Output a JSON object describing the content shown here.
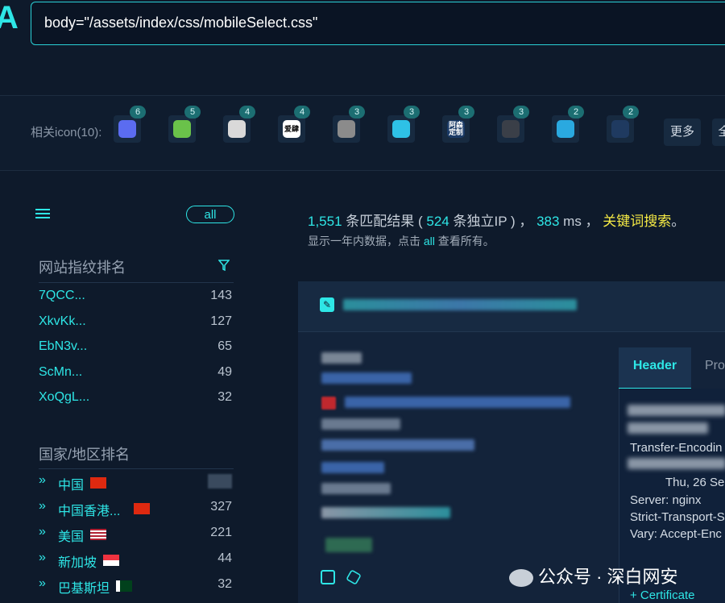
{
  "header": {
    "logo_text": "A",
    "query": "body=\"/assets/index/css/mobileSelect.css\""
  },
  "icon_bar": {
    "label": "相关icon(10):",
    "icons": [
      {
        "count": "6",
        "name": "macos-app-icon",
        "color": "#5b6cf0"
      },
      {
        "count": "5",
        "name": "green-stripes-icon",
        "color": "#6ac24a"
      },
      {
        "count": "4",
        "name": "cat-logo-icon",
        "color": "#d9d9d9"
      },
      {
        "count": "4",
        "name": "aiyi-logo-icon",
        "color": "#ffffff",
        "text": "爱肆"
      },
      {
        "count": "3",
        "name": "photo-thumb-icon",
        "color": "#8b8b8b"
      },
      {
        "count": "3",
        "name": "cloud-icon",
        "color": "#2ec1e6"
      },
      {
        "count": "3",
        "name": "asen-custom-icon",
        "color": "#1a3a66",
        "text": "阿森\n定制"
      },
      {
        "count": "3",
        "name": "apple-icon",
        "color": "#3a3f48"
      },
      {
        "count": "2",
        "name": "edge-e-icon",
        "color": "#2aa9e0"
      },
      {
        "count": "2",
        "name": "dark-circle-icon",
        "color": "#1f3a60"
      }
    ],
    "more_label": "更多",
    "all_label": "全"
  },
  "sidebar": {
    "all_label": "all",
    "fingerprint_title": "网站指纹排名",
    "fingerprints": [
      {
        "name": "7QCC...",
        "count": "143"
      },
      {
        "name": "XkvKk...",
        "count": "127"
      },
      {
        "name": "EbN3v...",
        "count": "65"
      },
      {
        "name": "ScMn...",
        "count": "49"
      },
      {
        "name": "XoQgL...",
        "count": "32"
      }
    ],
    "country_title": "国家/地区排名",
    "countries": [
      {
        "name": "中国",
        "count": "",
        "flag": "cn"
      },
      {
        "name": "中国香港...",
        "count": "327",
        "flag": "hk"
      },
      {
        "name": "美国",
        "count": "221",
        "flag": "us"
      },
      {
        "name": "新加坡",
        "count": "44",
        "flag": "sg"
      },
      {
        "name": "巴基斯坦",
        "count": "32",
        "flag": "pk"
      }
    ]
  },
  "summary": {
    "total": "1,551",
    "text1": " 条匹配结果 ( ",
    "unique_ip": "524",
    "text2": " 条独立IP ) ， ",
    "ms": "383",
    "text3": " ms ， ",
    "keyword_search": "关键词搜索",
    "end": "。",
    "sub_prefix": "显示一年内数据，点击 ",
    "sub_link": "all",
    "sub_suffix": " 查看所有。"
  },
  "result": {
    "tab_header": "Header",
    "tab_other": "Pro",
    "header_lines": [
      "Transfer-Encodin",
      "Thu, 26 Se",
      "Server: nginx",
      "Strict-Transport-S",
      "Vary: Accept-Enc"
    ],
    "certificate": "+ Certificate"
  },
  "watermark": {
    "text": "公众号 · 深白网安"
  },
  "colors": {
    "accent": "#2ee6e6",
    "keyword": "#f5ea45",
    "background": "#0e1a2b"
  }
}
